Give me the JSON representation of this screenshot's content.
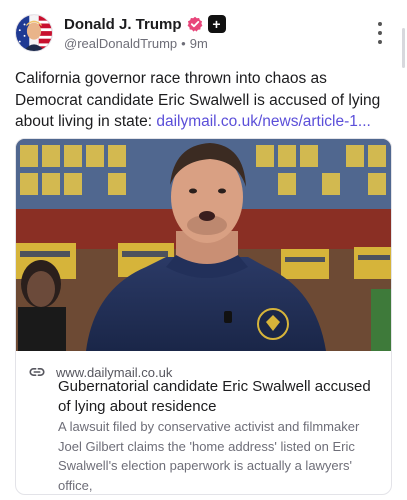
{
  "post": {
    "author": {
      "display_name": "Donald J. Trump",
      "handle": "@realDonaldTrump",
      "separator": "•",
      "timestamp": "9m",
      "avatar_icon": "flag-portrait-avatar",
      "verified_icon": "verified-badge-icon",
      "verified_color": "#e8457a",
      "plus_badge": "+"
    },
    "text": "California governor race thrown into chaos as Democrat candidate Eric Swalwell is accused of lying about living in state:",
    "link_text": "dailymail.co.uk/news/article-1...",
    "link_color": "#5b4fd9",
    "more_icon": "vertical-ellipsis-icon"
  },
  "card": {
    "domain": "www.dailymail.co.uk",
    "title": "Gubernatorial candidate Eric Swalwell accused of lying about residence",
    "description": "A lawsuit filed by conservative activist and filmmaker Joel Gilbert claims the 'home address' listed on Eric Swalwell's election paperwork is actually a lawyers' office,",
    "link_icon": "chain-link-icon",
    "image_desc_icon": "article-photo"
  }
}
